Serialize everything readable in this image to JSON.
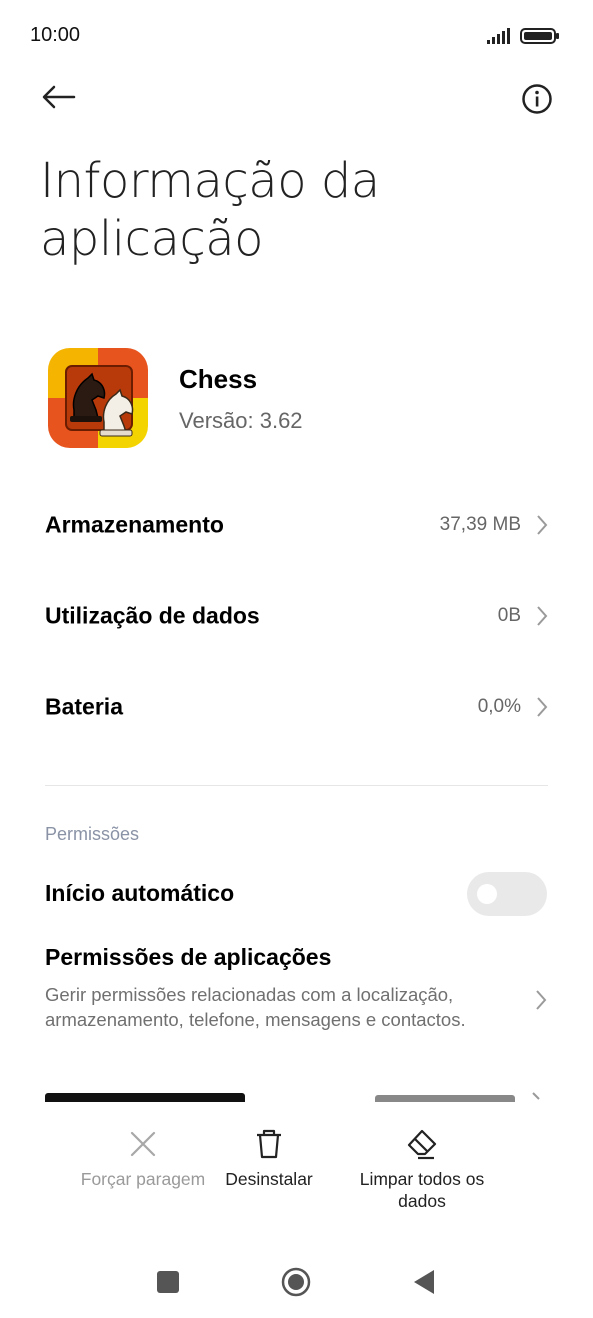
{
  "status_bar": {
    "time": "10:00"
  },
  "header": {
    "title": "Informação da aplicação"
  },
  "app": {
    "name": "Chess",
    "version": "Versão: 3.62"
  },
  "rows": [
    {
      "label": "Armazenamento",
      "value": "37,39 MB"
    },
    {
      "label": "Utilização de dados",
      "value": "0B"
    },
    {
      "label": "Bateria",
      "value": "0,0%"
    }
  ],
  "permissions": {
    "section_label": "Permissões",
    "autostart_label": "Início automático",
    "autostart_enabled": false,
    "app_permissions_title": "Permissões de aplicações",
    "app_permissions_desc": "Gerir permissões relacionadas com a localização, armazenamento, telefone, mensagens e contactos."
  },
  "actions": {
    "force_stop": "Forçar paragem",
    "uninstall": "Desinstalar",
    "clear_all": "Limpar todos os dados"
  },
  "icons": {
    "back": "arrow-left-icon",
    "info": "info-icon",
    "chevron": "chevron-right-icon",
    "force_stop": "close-icon",
    "uninstall": "trash-icon",
    "clear": "eraser-icon",
    "nav_recents": "square-icon",
    "nav_home": "circle-icon",
    "nav_back": "triangle-back-icon"
  },
  "colors": {
    "toggle_off": "#e9e9e9",
    "section_label": "#8a93a6"
  }
}
